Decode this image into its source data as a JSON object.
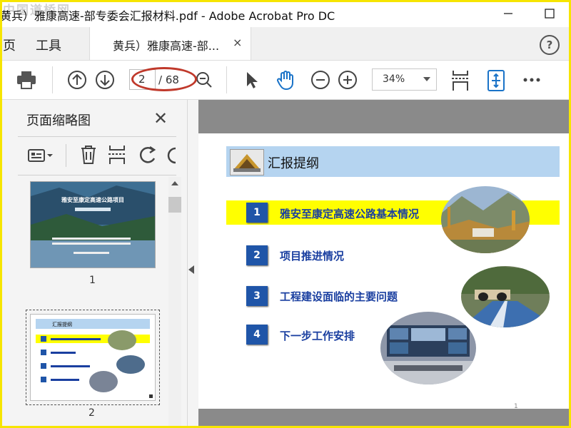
{
  "window": {
    "title": "黄兵）雅康高速-部专委会汇报材料.pdf - Adobe Acrobat Pro DC",
    "watermark": "中国道桥网"
  },
  "tabs": {
    "home": "页",
    "tools": "工具",
    "document": "黄兵）雅康高速-部...",
    "close": "×"
  },
  "toolbar": {
    "current_page": "2",
    "total_pages": "/ 68",
    "zoom": "34%",
    "icons": [
      "print-icon",
      "arrow-up-icon",
      "arrow-down-icon",
      "zoom-tool-icon",
      "pointer-icon",
      "hand-icon",
      "zoom-out-icon",
      "zoom-in-icon",
      "scroll-mode-icon",
      "fit-page-icon",
      "more-icon"
    ]
  },
  "sidebar": {
    "title": "页面缩略图",
    "thumbnails": [
      {
        "page_label": "1",
        "title": "雅安至康定高速公路项目"
      },
      {
        "page_label": "2",
        "title": "汇报提纲"
      }
    ]
  },
  "slide": {
    "header": "汇报提纲",
    "items": [
      {
        "num": "1",
        "text": "雅安至康定高速公路基本情况"
      },
      {
        "num": "2",
        "text": "项目推进情况"
      },
      {
        "num": "3",
        "text": "工程建设面临的主要问题"
      },
      {
        "num": "4",
        "text": "下一步工作安排"
      }
    ],
    "page_number": "1"
  },
  "colors": {
    "accent_blue": "#1f55a8",
    "header_blue": "#b5d4f0",
    "highlight": "#ffff00",
    "annotation_red": "#c0392b",
    "frame_yellow": "#f6e500"
  }
}
